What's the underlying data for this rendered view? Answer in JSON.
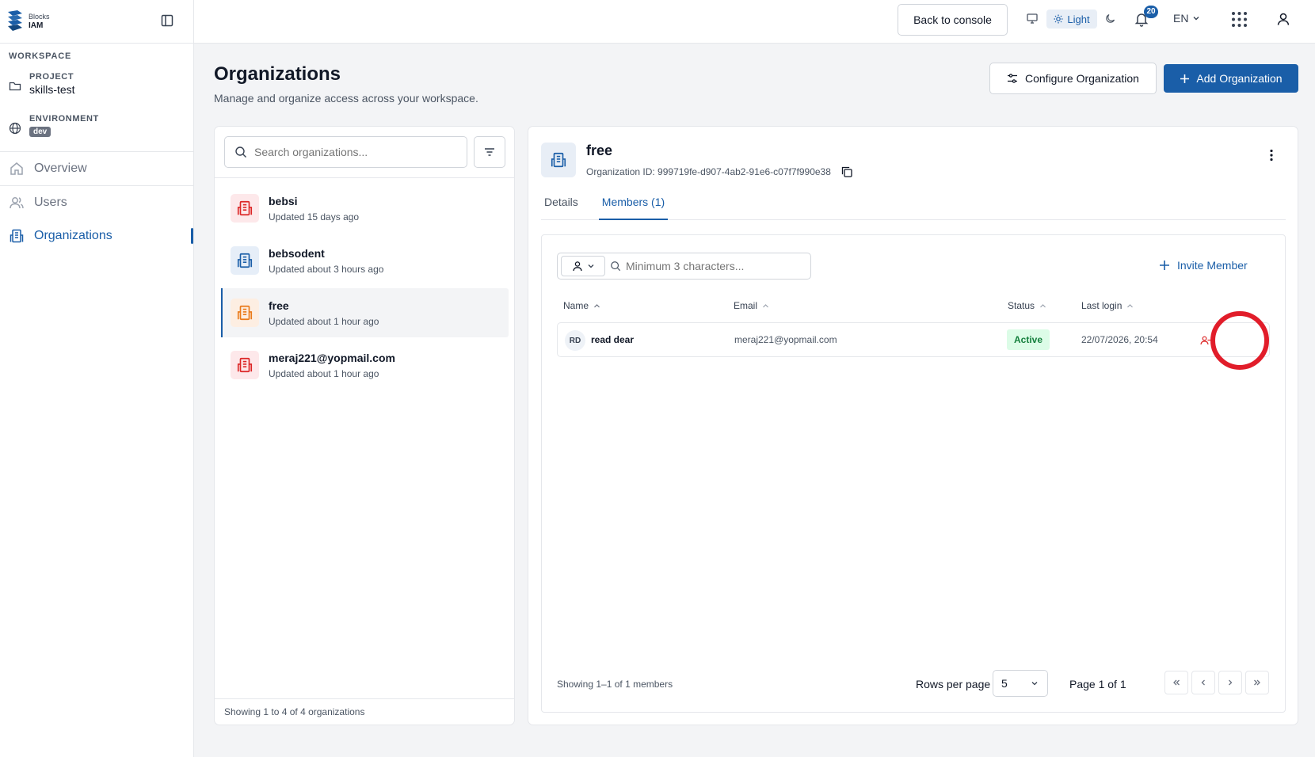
{
  "brand": {
    "line1": "Blocks",
    "line2": "IAM"
  },
  "sidebar": {
    "workspace_label": "WORKSPACE",
    "project_label": "PROJECT",
    "project_value": "skills-test",
    "environment_label": "ENVIRONMENT",
    "environment_value": "dev",
    "nav": [
      {
        "label": "Overview",
        "icon": "home-icon",
        "active": false
      },
      {
        "label": "Users",
        "icon": "users-icon",
        "active": false
      },
      {
        "label": "Organizations",
        "icon": "building-icon",
        "active": true
      }
    ]
  },
  "topbar": {
    "back_button": "Back to console",
    "theme_light_label": "Light",
    "notification_count": "20",
    "language": "EN"
  },
  "page": {
    "title": "Organizations",
    "subtitle": "Manage and organize access across your workspace.",
    "configure_button": "Configure Organization",
    "add_button": "Add Organization"
  },
  "org_list": {
    "search_placeholder": "Search organizations...",
    "items": [
      {
        "name": "bebsi",
        "updated": "Updated 15 days ago",
        "icon_color": "#dc2626",
        "icon_bg": "#fde8ea"
      },
      {
        "name": "bebsodent",
        "updated": "Updated about 3 hours ago",
        "icon_color": "#1a5ea8",
        "icon_bg": "#e6eef8"
      },
      {
        "name": "free",
        "updated": "Updated about 1 hour ago",
        "icon_color": "#ea7a1a",
        "icon_bg": "#fdeee2"
      },
      {
        "name": "meraj221@yopmail.com",
        "updated": "Updated about 1 hour ago",
        "icon_color": "#dc2626",
        "icon_bg": "#fde8ea"
      }
    ],
    "footer": "Showing 1 to 4 of 4 organizations"
  },
  "detail": {
    "name": "free",
    "org_id_text": "Organization ID: 999719fe-d907-4ab2-91e6-c07f7f990e38",
    "tabs": {
      "details": "Details",
      "members": "Members (1)"
    },
    "members": {
      "search_placeholder": "Minimum 3 characters...",
      "invite_button": "Invite Member",
      "columns": {
        "name": "Name",
        "email": "Email",
        "status": "Status",
        "last_login": "Last login"
      },
      "rows": [
        {
          "initials": "RD",
          "name": "read dear",
          "email": "meraj221@yopmail.com",
          "status": "Active",
          "last_login": "22/07/2026, 20:54"
        }
      ],
      "footer": "Showing 1–1 of 1 members",
      "rows_per_page_label": "Rows per page",
      "rows_per_page": "5",
      "page_info": "Page 1 of 1"
    }
  },
  "colors": {
    "accent": "#1a5ea8",
    "danger": "#e11d2a",
    "success_bg": "#dcfce7",
    "success_text": "#15803d"
  }
}
